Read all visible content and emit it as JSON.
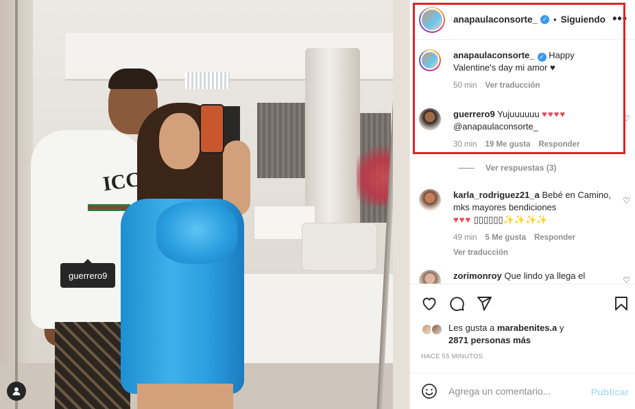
{
  "photo": {
    "tag_label": "guerrero9",
    "shirt_text": "ICCI"
  },
  "post_header": {
    "username": "anapaulaconsorte_",
    "separator": "•",
    "follow_label": "Siguiendo",
    "more_label": "•••"
  },
  "comments": [
    {
      "username": "anapaulaconsorte_",
      "text": "Happy Valentine's day mi amor ♥",
      "time": "50 min",
      "translate": "Ver traducción"
    },
    {
      "username": "guerrero9",
      "text": "Yujuuuuuu",
      "hearts": "♥♥♥♥",
      "mention": "@anapaulaconsorte_",
      "time": "30 min",
      "likes": "19 Me gusta",
      "reply": "Responder"
    },
    {
      "username": "karla_rodriguez21_a",
      "text": "Bebé en Camino, mks mayores bendiciones",
      "hearts": "♥♥♥",
      "extra": "▯▯▯▯▯▯✨✨✨✨",
      "time": "49 min",
      "likes": "5 Me gusta",
      "reply": "Responder",
      "translate": "Ver traducción"
    },
    {
      "username": "zorimonroy",
      "text": "Que lindo ya llega el"
    }
  ],
  "view_replies": "Ver respuestas (3)",
  "likes": {
    "prefix": "Les gusta a",
    "user": "marabenites.a",
    "connector": "y",
    "others": "2871 personas más"
  },
  "time_ago": "HACE 55 MINUTOS",
  "add_comment": {
    "placeholder": "Agrega un comentario...",
    "publish_label": "Publicar"
  },
  "colors": {
    "highlight": "#e0212b",
    "verified": "#3897f0",
    "heart": "#ed4956",
    "publish": "#b2dffc"
  }
}
